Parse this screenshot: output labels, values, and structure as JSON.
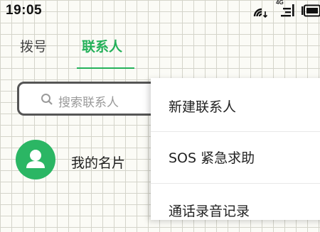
{
  "status_bar": {
    "time": "19:05",
    "icons": [
      "wifi-icon",
      "signal-icon",
      "battery-icon"
    ],
    "network_label": "4G"
  },
  "tabs": [
    {
      "label": "拨号",
      "active": false
    },
    {
      "label": "联系人",
      "active": true
    }
  ],
  "colors": {
    "accent": "#24b15a",
    "avatar": "#2bb664"
  },
  "search": {
    "placeholder": "搜索联系人",
    "icon": "search-icon"
  },
  "my_card": {
    "label": "我的名片",
    "icon": "person-icon"
  },
  "menu": {
    "items": [
      {
        "label": "新建联系人"
      },
      {
        "label": "SOS 紧急求助"
      },
      {
        "label": "通话录音记录"
      }
    ]
  }
}
